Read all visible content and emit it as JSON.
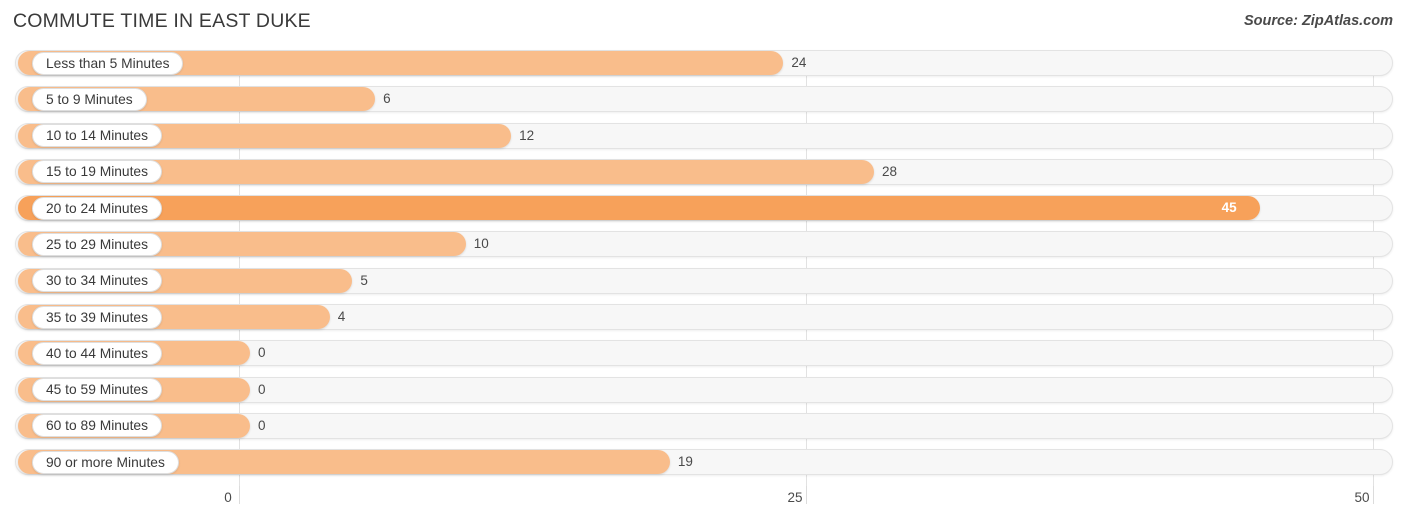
{
  "header": {
    "title": "COMMUTE TIME IN EAST DUKE",
    "source": "Source: ZipAtlas.com"
  },
  "colors": {
    "bar": "#f9bd8b",
    "bar_highlight": "#f7a15a",
    "track": "#f7f7f7",
    "grid": "#e2e2e2",
    "text": "#3d3d3d"
  },
  "chart_data": {
    "type": "bar",
    "orientation": "horizontal",
    "title": "COMMUTE TIME IN EAST DUKE",
    "xlabel": "",
    "ylabel": "",
    "xlim": [
      0,
      50
    ],
    "xticks": [
      0,
      25,
      50
    ],
    "xtick_labels": [
      "0",
      "25",
      "50"
    ],
    "grid": true,
    "legend": false,
    "categories": [
      "Less than 5 Minutes",
      "5 to 9 Minutes",
      "10 to 14 Minutes",
      "15 to 19 Minutes",
      "20 to 24 Minutes",
      "25 to 29 Minutes",
      "30 to 34 Minutes",
      "35 to 39 Minutes",
      "40 to 44 Minutes",
      "45 to 59 Minutes",
      "60 to 89 Minutes",
      "90 or more Minutes"
    ],
    "values": [
      24,
      6,
      12,
      28,
      45,
      10,
      5,
      4,
      0,
      0,
      0,
      19
    ],
    "value_labels": [
      "24",
      "6",
      "12",
      "28",
      "45",
      "10",
      "5",
      "4",
      "0",
      "0",
      "0",
      "19"
    ],
    "highlight_index": 4
  }
}
